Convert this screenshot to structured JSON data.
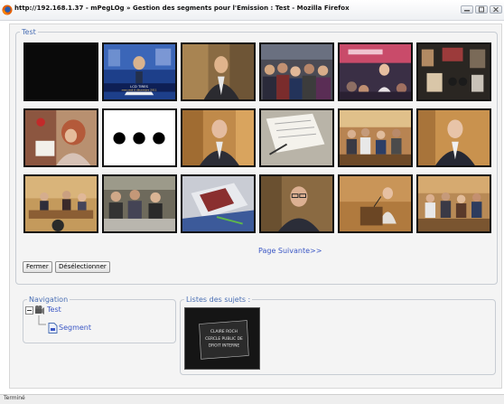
{
  "window": {
    "title": "http://192.168.1.37 - mPegLOg » Gestion des segments pour l'Emission : Test - Mozilla Firefox",
    "status": "Terminé"
  },
  "segments_panel": {
    "legend": "Test",
    "thumbnails": [
      {
        "scene": "black-frame"
      },
      {
        "scene": "news-anchor",
        "caption_line1": "LCD TIRES",
        "caption_line2": "mercredi 6 décembre 2011"
      },
      {
        "scene": "man-in-suit"
      },
      {
        "scene": "crowd-audience"
      },
      {
        "scene": "woman-speaking-crowd"
      },
      {
        "scene": "exhibition-stand"
      },
      {
        "scene": "woman-reading"
      },
      {
        "scene": "three-dots"
      },
      {
        "scene": "older-man-interview"
      },
      {
        "scene": "papers-desk"
      },
      {
        "scene": "meeting-room"
      },
      {
        "scene": "older-man-interview-2"
      },
      {
        "scene": "panel-table"
      },
      {
        "scene": "classroom-meeting"
      },
      {
        "scene": "book-on-desk"
      },
      {
        "scene": "man-with-glasses"
      },
      {
        "scene": "woman-at-podium"
      },
      {
        "scene": "audience-seated"
      }
    ],
    "next_page_link": "Page Suivante>>",
    "close_button": "Fermer",
    "deselect_button": "Désélectionner"
  },
  "navigation_panel": {
    "legend": "Navigation",
    "root_label": "Test",
    "child_label": "Segment"
  },
  "subjects_panel": {
    "legend": "Listes des sujets :",
    "thumbnail": {
      "scene": "sign-closeup",
      "line1": "CLAIRE ROCH",
      "line2": "CERCLE PUBLIC DE",
      "line3": "DROIT INTERNE"
    }
  }
}
